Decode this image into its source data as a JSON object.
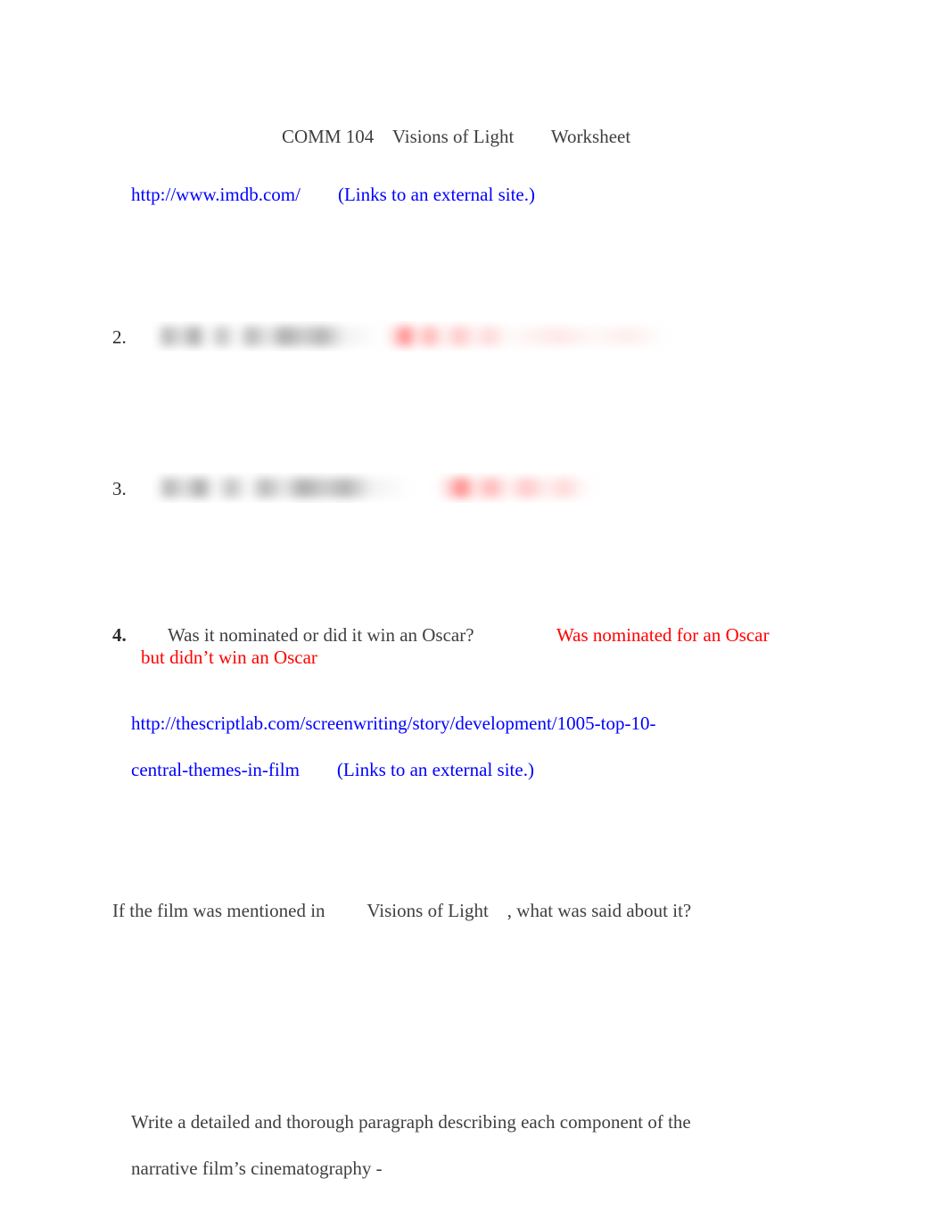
{
  "document": {
    "title_line": {
      "course": "COMM 104",
      "film": "Visions of Light",
      "kind": "Worksheet",
      "full": "COMM 104    Visions of Light        Worksheet"
    },
    "links": [
      {
        "url": "http://www.imdb.com/",
        "note": "(Links to an external site.)",
        "full": "http://www.imdb.com/        (Links to an external site.)"
      },
      {
        "url": "http://thescriptlab.com/screenwriting/story/development/1005-top-10-central-themes-in-film",
        "note": "(Links to an external site.)",
        "line1": "http://thescriptlab.com/screenwriting/story/development/1005-top-10-",
        "line2": "central-themes-in-film        (Links to an external site.)"
      }
    ],
    "items": [
      {
        "number": "2.",
        "question": "",
        "answer": "",
        "redacted": true
      },
      {
        "number": "3.",
        "question": "",
        "answer": "",
        "redacted": true
      },
      {
        "number": "4.",
        "question": "Was it nominated or did it win an Oscar?",
        "answer_line1": "Was nominated for an Oscar",
        "answer_line2": "but didn’t win an Oscar",
        "redacted": false
      }
    ],
    "prompts": [
      {
        "lead": "If the film was mentioned in",
        "emphasis": "Visions of Light",
        "tail": ", what was said about it?",
        "full": "If the film was mentioned in         Visions of Light    , what was said about it?"
      },
      {
        "line1": "Write a detailed and thorough paragraph describing each component of the",
        "line2": "narrative film’s cinematography -"
      }
    ],
    "colors": {
      "text": "#3f3f3f",
      "link": "#0000ff",
      "answer": "#ff0000",
      "page": "#ffffff"
    }
  }
}
